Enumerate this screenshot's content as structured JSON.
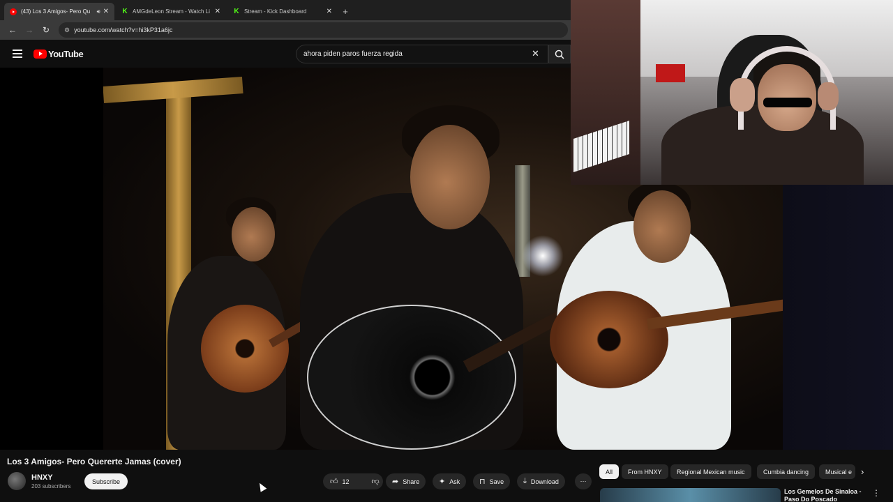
{
  "browser": {
    "tabs": [
      {
        "title": "(43) Los 3 Amigos- Pero Qu",
        "favicon": "youtube-icon",
        "active": true,
        "audio": true
      },
      {
        "title": "AMGdeLeon Stream - Watch Li",
        "favicon": "kick-icon",
        "active": false
      },
      {
        "title": "Stream - Kick Dashboard",
        "favicon": "kick-icon",
        "active": false
      }
    ],
    "new_tab": "+",
    "url": "youtube.com/watch?v=hi3kP31a6jc"
  },
  "youtube": {
    "logo_text": "YouTube",
    "search_query": "ahora piden paros fuerza regida"
  },
  "video": {
    "title": "Los 3 Amigos- Pero Quererte Jamas (cover)"
  },
  "channel": {
    "name": "HNXY",
    "subscribers": "203 subscribers",
    "subscribe_label": "Subscribe"
  },
  "actions": {
    "likes": "12",
    "share": "Share",
    "ask": "Ask",
    "save": "Save",
    "download": "Download"
  },
  "chips": [
    "All",
    "From HNXY",
    "Regional Mexican music",
    "Cumbia dancing",
    "Musical e"
  ],
  "recommendation": {
    "title": "Los Gemelos De Sinaloa - Paso Do Poscado (Official"
  },
  "colors": {
    "accent": "#ff0000",
    "kick": "#53fc18",
    "background": "#0f0f0f"
  }
}
